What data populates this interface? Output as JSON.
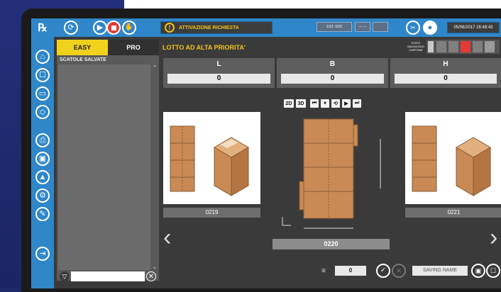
{
  "header": {
    "alert_text": "ATTIVAZIONE RICHIESTA",
    "datetime": "05/06/2017 16:48:43",
    "status_text": "STATO MAGAZZINO CARTONE",
    "mini1": "1/12",
    "mini2": "0/20",
    "mini3": "— —"
  },
  "left_panel": {
    "tab_easy": "EASY",
    "tab_pro": "PRO",
    "saved_label": "SCATOLE SALVATE"
  },
  "main": {
    "title": "LOTTO AD ALTA PRIORITA'",
    "dimensions": [
      {
        "label": "L",
        "value": "0"
      },
      {
        "label": "B",
        "value": "0"
      },
      {
        "label": "H",
        "value": "0"
      }
    ],
    "controls": [
      "2D",
      "3D",
      "⏮",
      "⏸",
      "⟲",
      "▶",
      "⏭"
    ],
    "boxes": [
      {
        "label": "0219"
      },
      {
        "label": "0220"
      },
      {
        "label": "0221"
      }
    ],
    "bottom_value": "0",
    "saving_name_placeholder": "SAVING NAME"
  },
  "colors": {
    "accent_blue": "#2f86c8",
    "highlight_yellow": "#f0d21c",
    "cardboard": "#c98a55"
  }
}
